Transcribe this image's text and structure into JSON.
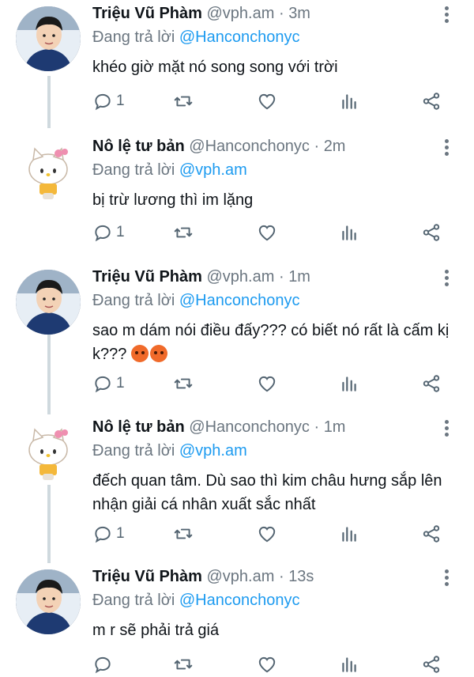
{
  "tweets": [
    {
      "name": "Triệu Vũ Phàm",
      "handle": "@vph.am",
      "time": "3m",
      "reply_prefix": "Đang trả lời",
      "reply_to": "@Hanconchonyc",
      "text": "khéo giờ mặt nó song song với trời",
      "reply_count": "1",
      "avatar": "boy"
    },
    {
      "name": "Nô lệ tư bản",
      "handle": "@Hanconchonyc",
      "time": "2m",
      "reply_prefix": "Đang trả lời",
      "reply_to": "@vph.am",
      "text": "bị trừ lương thì im lặng",
      "reply_count": "1",
      "avatar": "kitty"
    },
    {
      "name": "Triệu Vũ Phàm",
      "handle": "@vph.am",
      "time": "1m",
      "reply_prefix": "Đang trả lời",
      "reply_to": "@Hanconchonyc",
      "text": "sao m dám nói điều đấy??? có biết nó rất là cấm kị k???",
      "reply_count": "1",
      "avatar": "boy"
    },
    {
      "name": "Nô lệ tư bản",
      "handle": "@Hanconchonyc",
      "time": "1m",
      "reply_prefix": "Đang trả lời",
      "reply_to": "@vph.am",
      "text": "đếch quan tâm. Dù sao thì kim châu hưng sắp lên nhận giải cá nhân xuất sắc nhất",
      "reply_count": "1",
      "avatar": "kitty"
    },
    {
      "name": "Triệu Vũ Phàm",
      "handle": "@vph.am",
      "time": "13s",
      "reply_prefix": "Đang trả lời",
      "reply_to": "@Hanconchonyc",
      "text": "m r sẽ phải trả giá",
      "reply_count": "",
      "avatar": "boy"
    }
  ],
  "separator": "·",
  "icons": {
    "reply": "reply-icon",
    "retweet": "retweet-icon",
    "like": "heart-icon",
    "analytics": "analytics-icon",
    "share": "share-icon",
    "more": "more-vertical-icon",
    "angry_emoji": "angry-face-emoji"
  },
  "colors": {
    "mention": "#1d9bf0",
    "meta": "#6b7680",
    "thread_line": "#cfd9de"
  }
}
